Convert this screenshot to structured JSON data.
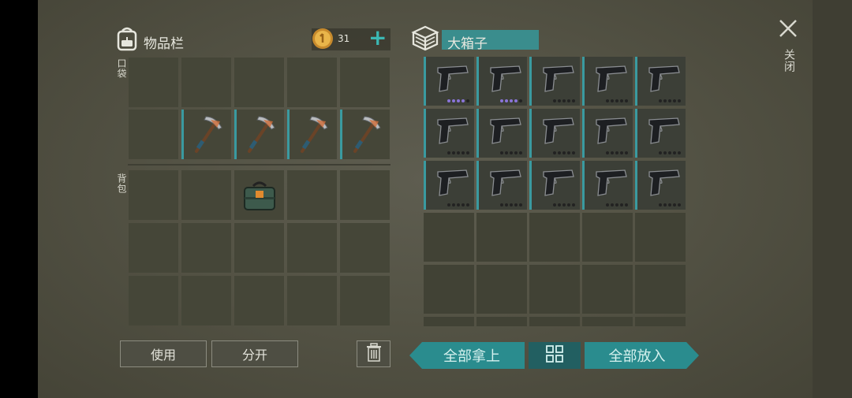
{
  "inventory": {
    "title": "物品栏",
    "icon": "backpack-icon",
    "coins": "31",
    "add_label": "+",
    "pocket_label": "口袋",
    "backpack_label": "背包",
    "hotbar_items": [
      "",
      "pickaxe",
      "pickaxe",
      "pickaxe",
      "pickaxe"
    ],
    "backpack_items": [
      "",
      "",
      "toolbox",
      "",
      "",
      "",
      "",
      "",
      "",
      "",
      "",
      "",
      "",
      "",
      ""
    ]
  },
  "container": {
    "title": "大箱子",
    "icon": "crate-icon",
    "items": [
      {
        "item": "pistol",
        "dots": "purple"
      },
      {
        "item": "pistol",
        "dots": "purple"
      },
      {
        "item": "pistol",
        "dots": "dark"
      },
      {
        "item": "pistol",
        "dots": "dark"
      },
      {
        "item": "pistol",
        "dots": "dark"
      },
      {
        "item": "pistol",
        "dots": "dark"
      },
      {
        "item": "pistol",
        "dots": "dark"
      },
      {
        "item": "pistol",
        "dots": "dark"
      },
      {
        "item": "pistol",
        "dots": "dark"
      },
      {
        "item": "pistol",
        "dots": "dark"
      },
      {
        "item": "pistol",
        "dots": "dark"
      },
      {
        "item": "pistol",
        "dots": "dark"
      },
      {
        "item": "pistol",
        "dots": "dark"
      },
      {
        "item": "pistol",
        "dots": "dark"
      },
      {
        "item": "pistol",
        "dots": "dark"
      }
    ]
  },
  "buttons": {
    "use": "使用",
    "split": "分开",
    "take_all": "全部拿上",
    "put_all": "全部放入",
    "sort_icon": "grid-sort-icon",
    "trash_icon": "trash-icon"
  },
  "close": {
    "icon": "close-icon",
    "label": "关闭"
  },
  "colors": {
    "accent": "#2a8c8e",
    "coin": "#d9a441",
    "background": "#545345"
  }
}
